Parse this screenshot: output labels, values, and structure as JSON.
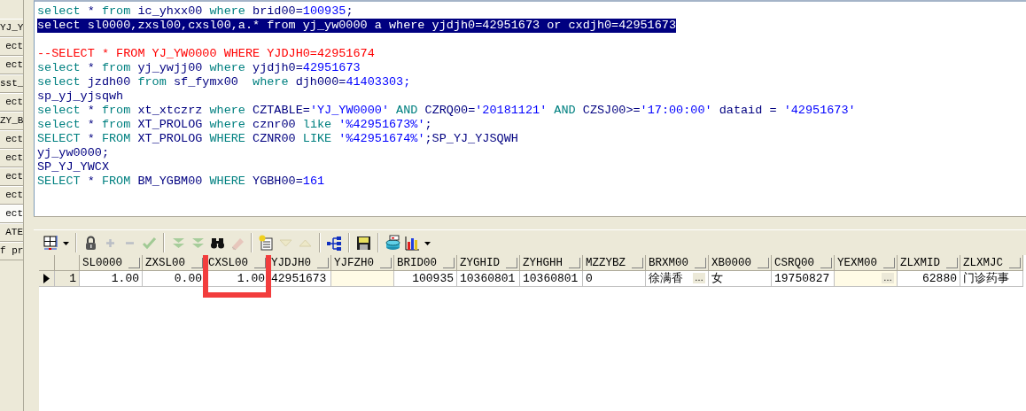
{
  "side_tabs": [
    {
      "label": "YJ_Y",
      "selected": false
    },
    {
      "label": "ect",
      "selected": false
    },
    {
      "label": "ect",
      "selected": false
    },
    {
      "label": "sst_",
      "selected": false
    },
    {
      "label": "ect",
      "selected": false
    },
    {
      "label": "ZY_B",
      "selected": false
    },
    {
      "label": "ect",
      "selected": false
    },
    {
      "label": "ect",
      "selected": false
    },
    {
      "label": "ect",
      "selected": false
    },
    {
      "label": "ect",
      "selected": false
    },
    {
      "label": "ect",
      "selected": true
    },
    {
      "label": "ATE",
      "selected": false
    },
    {
      "label": "f pr",
      "selected": false
    }
  ],
  "editor": {
    "lines": [
      {
        "kind": "code",
        "selected": false,
        "tokens": [
          {
            "kind": "kw",
            "text": "select"
          },
          {
            "kind": "id",
            "text": " * "
          },
          {
            "kind": "kw",
            "text": "from"
          },
          {
            "kind": "id",
            "text": " ic_yhxx00 "
          },
          {
            "kind": "kw",
            "text": "where"
          },
          {
            "kind": "id",
            "text": " brid00="
          },
          {
            "kind": "num",
            "text": "100935"
          },
          {
            "kind": "id",
            "text": ";"
          }
        ]
      },
      {
        "kind": "code",
        "selected": true,
        "tokens": [
          {
            "kind": "id",
            "text": "select sl0000,zxsl00,cxsl00,a.* from yj_yw0000 a where yjdjh0=42951673 or cxdjh0=42951673"
          }
        ]
      },
      {
        "kind": "blank"
      },
      {
        "kind": "code",
        "selected": false,
        "tokens": [
          {
            "kind": "comment",
            "text": "--SELECT * FROM YJ_YW0000 WHERE YJDJH0=42951674"
          }
        ]
      },
      {
        "kind": "code",
        "selected": false,
        "tokens": [
          {
            "kind": "kw",
            "text": "select"
          },
          {
            "kind": "id",
            "text": " * "
          },
          {
            "kind": "kw",
            "text": "from"
          },
          {
            "kind": "id",
            "text": " yj_ywjj00 "
          },
          {
            "kind": "kw",
            "text": "where"
          },
          {
            "kind": "id",
            "text": " yjdjh0="
          },
          {
            "kind": "num",
            "text": "42951673"
          }
        ]
      },
      {
        "kind": "code",
        "selected": false,
        "tokens": [
          {
            "kind": "kw",
            "text": "select"
          },
          {
            "kind": "id",
            "text": " jzdh00 "
          },
          {
            "kind": "kw",
            "text": "from"
          },
          {
            "kind": "id",
            "text": " sf_fymx00  "
          },
          {
            "kind": "kw",
            "text": "where"
          },
          {
            "kind": "id",
            "text": " djh000="
          },
          {
            "kind": "num",
            "text": "41403303;"
          }
        ]
      },
      {
        "kind": "code",
        "selected": false,
        "tokens": [
          {
            "kind": "id",
            "text": "sp_yj_yjsqwh"
          }
        ]
      },
      {
        "kind": "code",
        "selected": false,
        "tokens": [
          {
            "kind": "kw",
            "text": "select"
          },
          {
            "kind": "id",
            "text": " * "
          },
          {
            "kind": "kw",
            "text": "from"
          },
          {
            "kind": "id",
            "text": " xt_xtczrz "
          },
          {
            "kind": "kw",
            "text": "where"
          },
          {
            "kind": "id",
            "text": " CZTABLE="
          },
          {
            "kind": "num",
            "text": "'YJ_YW0000'"
          },
          {
            "kind": "kw",
            "text": " AND "
          },
          {
            "kind": "id",
            "text": "CZRQ00="
          },
          {
            "kind": "num",
            "text": "'20181121'"
          },
          {
            "kind": "kw",
            "text": " AND "
          },
          {
            "kind": "id",
            "text": "CZSJ00>="
          },
          {
            "kind": "num",
            "text": "'17:00:00'"
          },
          {
            "kind": "id",
            "text": " dataid = "
          },
          {
            "kind": "num",
            "text": "'42951673'"
          }
        ]
      },
      {
        "kind": "code",
        "selected": false,
        "tokens": [
          {
            "kind": "kw",
            "text": "select"
          },
          {
            "kind": "id",
            "text": " * "
          },
          {
            "kind": "kw",
            "text": "from"
          },
          {
            "kind": "id",
            "text": " XT_PROLOG "
          },
          {
            "kind": "kw",
            "text": "where"
          },
          {
            "kind": "id",
            "text": " cznr00 "
          },
          {
            "kind": "kw",
            "text": "like"
          },
          {
            "kind": "num",
            "text": " '%42951673%'"
          },
          {
            "kind": "id",
            "text": ";"
          }
        ]
      },
      {
        "kind": "code",
        "selected": false,
        "tokens": [
          {
            "kind": "kw",
            "text": "SELECT"
          },
          {
            "kind": "id",
            "text": " * "
          },
          {
            "kind": "kw",
            "text": "FROM"
          },
          {
            "kind": "id",
            "text": " XT_PROLOG "
          },
          {
            "kind": "kw",
            "text": "WHERE"
          },
          {
            "kind": "id",
            "text": " CZNR00 "
          },
          {
            "kind": "kw",
            "text": "LIKE"
          },
          {
            "kind": "num",
            "text": " '%42951674%'"
          },
          {
            "kind": "id",
            "text": ";SP_YJ_YJSQWH"
          }
        ]
      },
      {
        "kind": "code",
        "selected": false,
        "tokens": [
          {
            "kind": "id",
            "text": "yj_yw0000;"
          }
        ]
      },
      {
        "kind": "code",
        "selected": false,
        "tokens": [
          {
            "kind": "id",
            "text": "SP_YJ_YWCX"
          }
        ]
      },
      {
        "kind": "code",
        "selected": false,
        "tokens": [
          {
            "kind": "kw",
            "text": "SELECT"
          },
          {
            "kind": "id",
            "text": " * "
          },
          {
            "kind": "kw",
            "text": "FROM"
          },
          {
            "kind": "id",
            "text": " BM_YGBM00 "
          },
          {
            "kind": "kw",
            "text": "WHERE"
          },
          {
            "kind": "id",
            "text": " YGBH00="
          },
          {
            "kind": "num",
            "text": "161"
          }
        ]
      }
    ]
  },
  "toolbar": {
    "items": [
      {
        "kind": "grid",
        "disabled": false
      },
      {
        "kind": "caret",
        "disabled": false
      },
      {
        "kind": "sep"
      },
      {
        "kind": "lock",
        "disabled": false
      },
      {
        "kind": "plus",
        "disabled": true
      },
      {
        "kind": "minus",
        "disabled": true
      },
      {
        "kind": "check",
        "disabled": true
      },
      {
        "kind": "sep"
      },
      {
        "kind": "double_down",
        "disabled": true
      },
      {
        "kind": "double_down",
        "disabled": true
      },
      {
        "kind": "binoculars",
        "disabled": false
      },
      {
        "kind": "eraser",
        "disabled": true
      },
      {
        "kind": "sep"
      },
      {
        "kind": "notes",
        "disabled": false
      },
      {
        "kind": "tri_down",
        "disabled": true
      },
      {
        "kind": "tri_up",
        "disabled": true
      },
      {
        "kind": "sep"
      },
      {
        "kind": "tree",
        "disabled": false
      },
      {
        "kind": "sep"
      },
      {
        "kind": "save",
        "disabled": false
      },
      {
        "kind": "sep"
      },
      {
        "kind": "database",
        "disabled": false
      },
      {
        "kind": "chart",
        "disabled": false
      },
      {
        "kind": "caret",
        "disabled": false
      }
    ]
  },
  "table": {
    "columns": [
      {
        "label": "SL0000",
        "right_aligned": true,
        "shaded": false,
        "marked": false
      },
      {
        "label": "ZXSL00",
        "right_aligned": true,
        "shaded": false,
        "marked": false
      },
      {
        "label": "CXSL00",
        "right_aligned": true,
        "shaded": false,
        "marked": true
      },
      {
        "label": "YJDJH0",
        "right_aligned": false,
        "shaded": false,
        "marked": false
      },
      {
        "label": "YJFZH0",
        "right_aligned": false,
        "shaded": true,
        "marked": false
      },
      {
        "label": "BRID00",
        "right_aligned": true,
        "shaded": false,
        "marked": false
      },
      {
        "label": "ZYGHID",
        "right_aligned": false,
        "shaded": false,
        "marked": false
      },
      {
        "label": "ZYHGHH",
        "right_aligned": false,
        "shaded": false,
        "marked": false
      },
      {
        "label": "MZZYBZ",
        "right_aligned": false,
        "shaded": false,
        "marked": false
      },
      {
        "label": "BRXM00",
        "right_aligned": false,
        "shaded": false,
        "marked": false,
        "button": "…"
      },
      {
        "label": "XB0000",
        "right_aligned": false,
        "shaded": false,
        "marked": false
      },
      {
        "label": "CSRQ00",
        "right_aligned": false,
        "shaded": false,
        "marked": false
      },
      {
        "label": "YEXM00",
        "right_aligned": false,
        "shaded": true,
        "marked": false,
        "button": "…"
      },
      {
        "label": "ZLXMID",
        "right_aligned": true,
        "shaded": false,
        "marked": false
      },
      {
        "label": "ZLXMJC",
        "right_aligned": false,
        "shaded": false,
        "marked": false
      }
    ],
    "rows": [
      {
        "number": "1",
        "current": true,
        "cells": [
          "1.00",
          "0.00",
          "1.00",
          "42951673",
          null,
          "100935",
          "10360801",
          "10360801",
          "0",
          "徐满香",
          "女",
          "19750827",
          null,
          "62880",
          "门诊药事"
        ]
      }
    ]
  }
}
